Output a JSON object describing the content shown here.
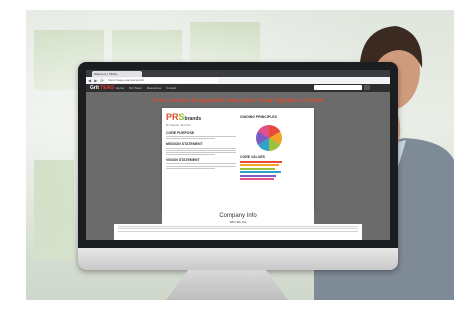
{
  "browser": {
    "tab_title": "Welcome | TEAG",
    "url": "https://teag.example/portal",
    "nav_glyphs": "◀ ▶ ⟳"
  },
  "site": {
    "logo_prefix": "Grit",
    "logo_suffix": "TEAG",
    "nav_items": [
      "Home",
      "Our Team",
      "Resources",
      "Contact"
    ],
    "banner": "Grow Greater Responsible Innovative Team Together at Prism"
  },
  "document": {
    "brand_prefix": "PR",
    "brand_suffix": "S",
    "brand_rest": "brands",
    "brand_tagline": "Be Together, Be Prism",
    "left_headings": [
      "CORE PURPOSE",
      "MISSION STATEMENT",
      "VISION STATEMENT"
    ],
    "right_headings": [
      "GUIDING PRINCIPLES",
      "CORE VALUES"
    ]
  },
  "company_info": {
    "title": "Company Info",
    "subtitle": "Who We Are"
  },
  "colors": {
    "accent_red": "#e04a2c",
    "brand_green": "#8fbf2e"
  }
}
